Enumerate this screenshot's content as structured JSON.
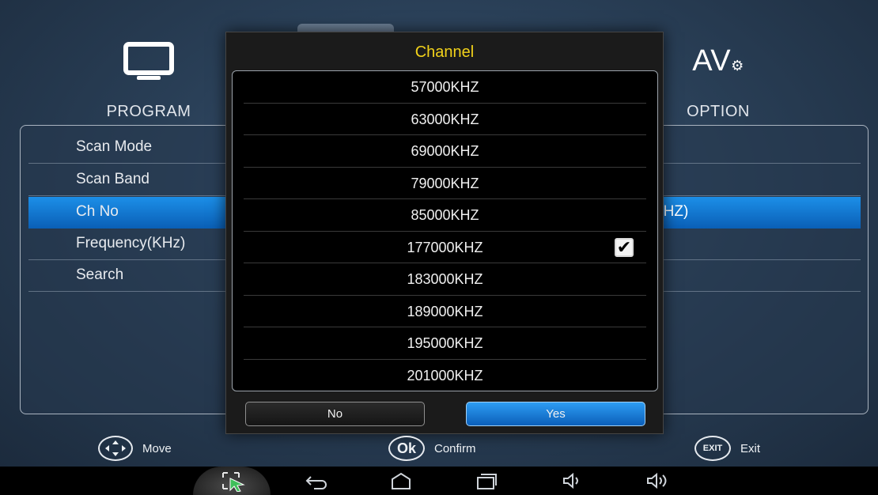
{
  "top_menu": {
    "program": "PROGRAM",
    "option": "OPTION",
    "av_text": "AV",
    "av_gear": "⚙"
  },
  "settings_rows": [
    {
      "label": "Scan Mode",
      "value": ""
    },
    {
      "label": "Scan Band",
      "value": ""
    },
    {
      "label": "Ch No",
      "value": "KHZ)"
    },
    {
      "label": "Frequency(KHz)",
      "value": ""
    },
    {
      "label": "Search",
      "value": ""
    }
  ],
  "dialog": {
    "title": "Channel",
    "items": [
      "57000KHZ",
      "63000KHZ",
      "69000KHZ",
      "79000KHZ",
      "85000KHZ",
      "177000KHZ",
      "183000KHZ",
      "189000KHZ",
      "195000KHZ",
      "201000KHZ"
    ],
    "checked_item": "177000KHZ",
    "check_glyph": "✔",
    "no_label": "No",
    "yes_label": "Yes"
  },
  "hints": {
    "move_label": "Move",
    "confirm_badge": "Ok",
    "confirm_label": "Confirm",
    "exit_badge": "EXIT",
    "exit_label": "Exit"
  },
  "colors": {
    "dialog_title": "#f2d21a",
    "selection_blue": "#1c8fe8"
  },
  "icons": [
    "tv-icon",
    "search-icon",
    "gear-icon",
    "av-settings-icon",
    "dpad-icon",
    "mouse-pointer-icon",
    "back-icon",
    "home-icon",
    "recents-icon",
    "volume-down-icon",
    "volume-up-icon"
  ]
}
